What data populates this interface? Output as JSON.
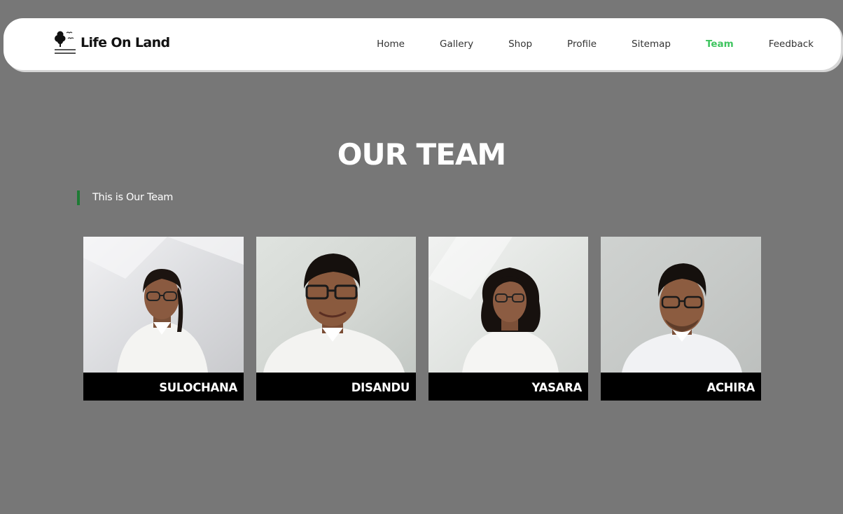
{
  "brand": {
    "name": "Life On Land",
    "icon": "tree-birds-logo-icon"
  },
  "nav": {
    "items": [
      {
        "label": "Home"
      },
      {
        "label": "Gallery"
      },
      {
        "label": "Shop"
      },
      {
        "label": "Profile"
      },
      {
        "label": "Sitemap"
      },
      {
        "label": "Team"
      },
      {
        "label": "Feedback"
      }
    ],
    "active": "Team",
    "active_color": "#3ec45f"
  },
  "page": {
    "title": "OUR TEAM",
    "subtitle": "This is Our Team",
    "accent_color": "#1e7b34",
    "background_color": "#777777"
  },
  "team": {
    "members": [
      {
        "name": "SULOCHANA"
      },
      {
        "name": "DISANDU"
      },
      {
        "name": "YASARA"
      },
      {
        "name": "ACHIRA"
      }
    ]
  }
}
